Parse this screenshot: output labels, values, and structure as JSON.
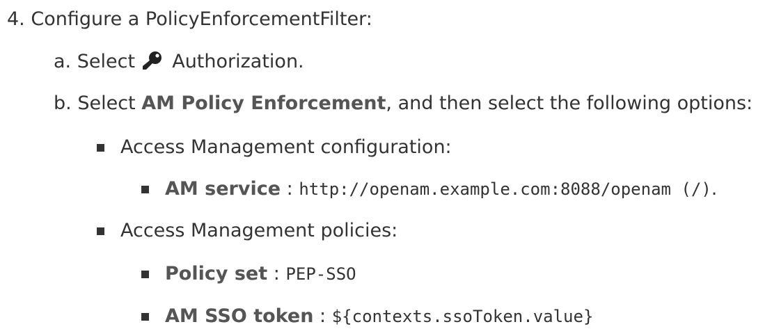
{
  "steps": {
    "step4": {
      "marker": "4.",
      "text": "Configure a PolicyEnforcementFilter:"
    },
    "a": {
      "marker": "a.",
      "pre": "Select",
      "icon": "key-icon",
      "post": "Authorization."
    },
    "b": {
      "marker": "b.",
      "pre": "Select",
      "strong": "AM Policy Enforcement",
      "post": ", and then select the following options:"
    }
  },
  "options": {
    "access_config": {
      "label": "Access Management configuration:",
      "items": [
        {
          "term": "AM service",
          "sep": ":",
          "code": "http://openam.example.com:8088/openam (/)",
          "end": "."
        }
      ]
    },
    "access_policies": {
      "label": "Access Management policies:",
      "items": [
        {
          "term": "Policy set",
          "sep": ":",
          "code": "PEP-SSO"
        },
        {
          "term": "AM SSO token",
          "sep": ":",
          "code": "${contexts.ssoToken.value}"
        }
      ]
    }
  }
}
